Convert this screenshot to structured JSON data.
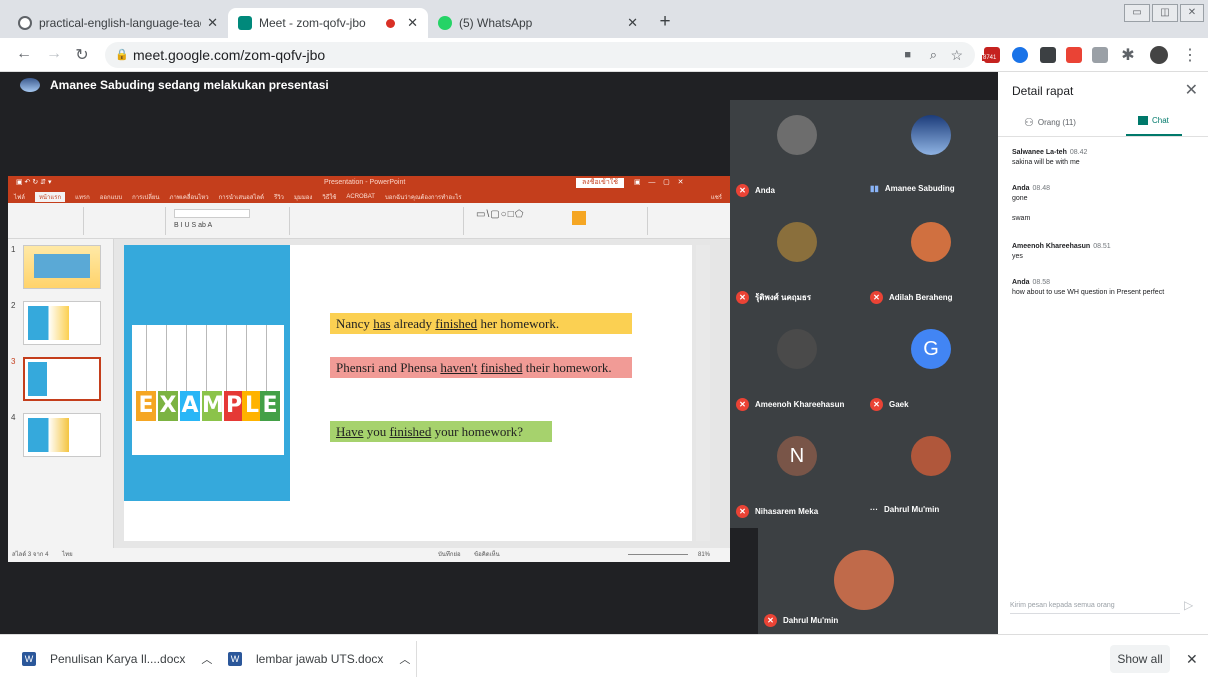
{
  "browser": {
    "tabs": [
      {
        "title": "practical-english-language-teach",
        "color": "#5f6368"
      },
      {
        "title": "Meet - zom-qofv-jbo",
        "color": "#00897b"
      },
      {
        "title": "(5) WhatsApp",
        "color": "#25d366"
      }
    ],
    "new_tab": "+",
    "url": "meet.google.com/zom-qofv-jbo",
    "extension_badge": "8741"
  },
  "presenting_banner": "Amanee Sabuding sedang melakukan presentasi",
  "powerpoint": {
    "title": "Presentation - PowerPoint",
    "signin": "ลงชื่อเข้าใช้",
    "menu": [
      "ไฟล์",
      "หน้าแรก",
      "แทรก",
      "ออกแบบ",
      "การเปลี่ยน",
      "ภาพเคลื่อนไหว",
      "การนำเสนอสไลด์",
      "รีวิว",
      "มุมมอง",
      "วิธีใช้",
      "ACROBAT",
      "บอกฉันว่าคุณต้องการทำอะไร"
    ],
    "share": "แชร์",
    "slide_numbers": [
      "1",
      "2",
      "3",
      "4"
    ],
    "status_left": "สไลด์ 3 จาก 4",
    "status_lang": "ไทย",
    "status_notes": "บันทึกย่อ",
    "status_comments": "ข้อคิดเห็น",
    "zoom": "81%",
    "example_word": "EXAMPLE",
    "sentences": [
      {
        "pre": "Nancy ",
        "u1": "has",
        "mid": " already ",
        "u2": "finished",
        "post": " her homework.",
        "bg": "#fbd052"
      },
      {
        "pre": "Phensri and Phensa ",
        "u1": "haven't",
        "mid": " ",
        "u2": "finished",
        "post": " their homework.",
        "bg": "#f19b96"
      },
      {
        "pre": "",
        "u1": "Have",
        "mid": " you ",
        "u2": "finished",
        "post": " your homework?",
        "bg": "#a6d26d"
      }
    ]
  },
  "participants": [
    {
      "name": "Anda",
      "muted": true,
      "avatar_color": "#6d6d6d"
    },
    {
      "name": "Amanee Sabuding",
      "muted": false,
      "avatar_color": "#3a5f9a"
    },
    {
      "name": "รุ้ติพงศ์ นคฤมธร",
      "muted": true,
      "avatar_color": "#8a6f3c"
    },
    {
      "name": "Adilah Beraheng",
      "muted": true,
      "avatar_color": "#d07040"
    },
    {
      "name": "Ameenoh Khareehasun",
      "muted": true,
      "avatar_color": "#4a4a4a"
    },
    {
      "name": "Gaek",
      "muted": true,
      "avatar_letter": "G",
      "avatar_color": "#4285f4"
    },
    {
      "name": "Nihasarem Meka",
      "muted": true,
      "avatar_letter": "N",
      "avatar_color": "#795548"
    },
    {
      "name": "Dahrul Mu'min",
      "muted": false,
      "avatar_color": "#b0573b"
    }
  ],
  "solo_participant": {
    "name": "Dahrul Mu'min",
    "muted": true
  },
  "sidebar": {
    "title": "Detail rapat",
    "tab_people": "Orang (11)",
    "tab_chat": "Chat",
    "messages": [
      {
        "sender": "Salwanee La-teh",
        "time": "08.42",
        "lines": [
          "sakina will be with me"
        ]
      },
      {
        "sender": "Anda",
        "time": "08.48",
        "lines": [
          "gone",
          "",
          "swam"
        ]
      },
      {
        "sender": "Ameenoh Khareehasun",
        "time": "08.51",
        "lines": [
          "yes"
        ]
      },
      {
        "sender": "Anda",
        "time": "08.58",
        "lines": [
          "how about to use WH question in Present perfect"
        ]
      }
    ],
    "input_placeholder": "Kirim pesan kepada semua orang"
  },
  "downloads": [
    {
      "name": "Penulisan Karya Il....docx"
    },
    {
      "name": "lembar jawab UTS.docx"
    }
  ],
  "show_all": "Show all"
}
